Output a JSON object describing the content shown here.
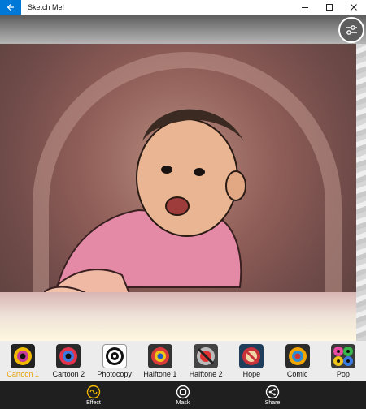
{
  "window": {
    "title": "Sketch Me!",
    "back_icon": "back-arrow-icon",
    "minimize_icon": "minimize-icon",
    "maximize_icon": "maximize-icon",
    "close_icon": "close-icon"
  },
  "canvas": {
    "settings_icon": "sliders-icon"
  },
  "effects": {
    "selected": "Cartoon 1",
    "items": [
      {
        "label": "Cartoon 1",
        "icon": "cartoon-lens-icon"
      },
      {
        "label": "Cartoon 2",
        "icon": "cartoon-lens-icon"
      },
      {
        "label": "Photocopy",
        "icon": "photocopy-lens-icon"
      },
      {
        "label": "Halftone 1",
        "icon": "halftone-lens-icon"
      },
      {
        "label": "Halftone 2",
        "icon": "halftone-lens-icon"
      },
      {
        "label": "Hope",
        "icon": "hope-lens-icon"
      },
      {
        "label": "Comic",
        "icon": "comic-lens-icon"
      },
      {
        "label": "Pop",
        "icon": "pop-lens-icon"
      }
    ]
  },
  "appbar": {
    "effect_label": "Effect",
    "mask_label": "Mask",
    "share_label": "Share"
  },
  "colors": {
    "accent": "#0078d7",
    "selected_label": "#e6a200",
    "appbar_bg": "#1f1f1f"
  }
}
